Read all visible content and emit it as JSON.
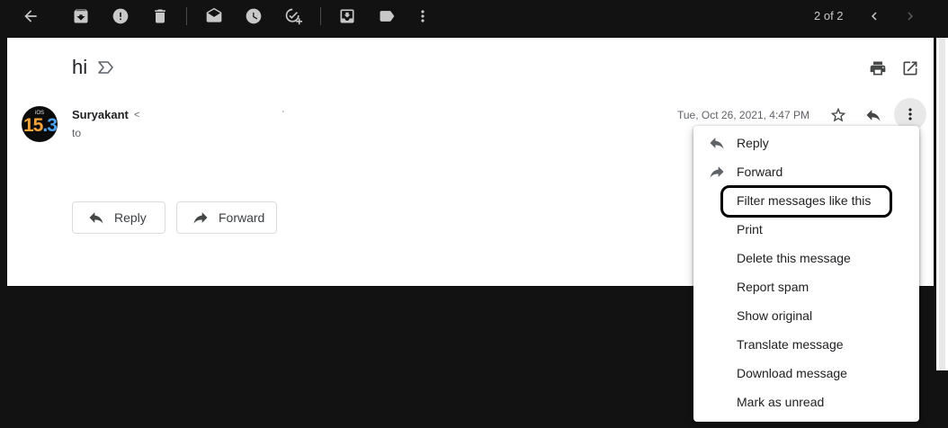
{
  "toolbar": {
    "icons": [
      "back-arrow-icon",
      "archive-icon",
      "report-spam-icon",
      "delete-icon",
      "mark-unread-icon",
      "snooze-icon",
      "add-to-tasks-icon",
      "move-to-icon",
      "labels-icon",
      "more-vert-icon"
    ],
    "pager": "2 of 2"
  },
  "email": {
    "subject": "hi",
    "sender_name": "Suryakant",
    "sender_email_fragment": "<",
    "dot": "·",
    "to_label": "to",
    "date": "Tue, Oct 26, 2021, 4:47 PM",
    "avatar": {
      "small": "iOS",
      "num_left": "15",
      "num_dot": ".",
      "num_right": "3"
    },
    "reply_label": "Reply",
    "forward_label": "Forward"
  },
  "menu": {
    "items": [
      {
        "label": "Reply",
        "icon": "reply-icon"
      },
      {
        "label": "Forward",
        "icon": "forward-icon"
      },
      {
        "label": "Filter messages like this"
      },
      {
        "label": "Print"
      },
      {
        "label": "Delete this message"
      },
      {
        "label": "Report spam"
      },
      {
        "label": "Show original"
      },
      {
        "label": "Translate message"
      },
      {
        "label": "Download message"
      },
      {
        "label": "Mark as unread"
      }
    ]
  },
  "colors": {
    "background": "#121212",
    "card": "#ffffff",
    "highlight_ring": "#000000"
  }
}
